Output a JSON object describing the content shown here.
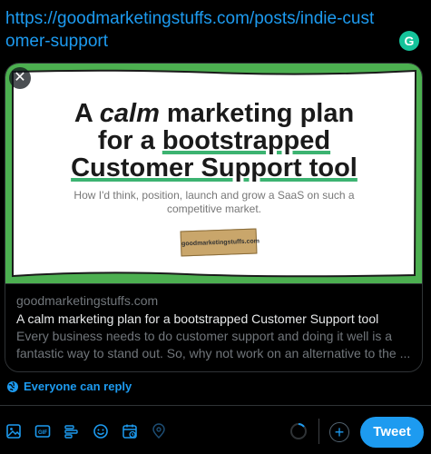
{
  "composer": {
    "url_text": "https://goodmarketingstuffs.com/posts/indie-customer-support"
  },
  "grammarly": {
    "icon": "grammarly-icon",
    "letter": "G",
    "color": "#15c39a"
  },
  "link_card": {
    "image": {
      "headline_pre": "A ",
      "headline_em": "calm",
      "headline_post": " marketing plan",
      "headline_line2_pre": "for a ",
      "headline_line2_u": "bootstrapped",
      "headline_line3": "Customer Support tool",
      "subline": "How I'd think, position, launch and grow a SaaS on such a competitive market.",
      "stamp_text": "goodmarketingstuffs.com",
      "border_color": "#4caf50"
    },
    "close_icon": "✕",
    "domain": "goodmarketingstuffs.com",
    "title": "A calm marketing plan for a bootstrapped Customer Support tool",
    "description": "Every business needs to do customer support and doing it well is a fantastic way to stand out. So, why not work on an alternative to the ..."
  },
  "reply_setting": {
    "icon": "globe-icon",
    "label": "Everyone can reply"
  },
  "toolbar": {
    "icons": [
      "image-icon",
      "gif-icon",
      "poll-icon",
      "emoji-icon",
      "schedule-icon",
      "location-icon"
    ],
    "gif_label": "GIF"
  },
  "add_thread": {
    "icon": "plus-icon",
    "symbol": "+"
  },
  "tweet_button": {
    "label": "Tweet"
  },
  "colors": {
    "accent": "#1d9bf0",
    "background": "#000000",
    "muted": "#71767b"
  }
}
